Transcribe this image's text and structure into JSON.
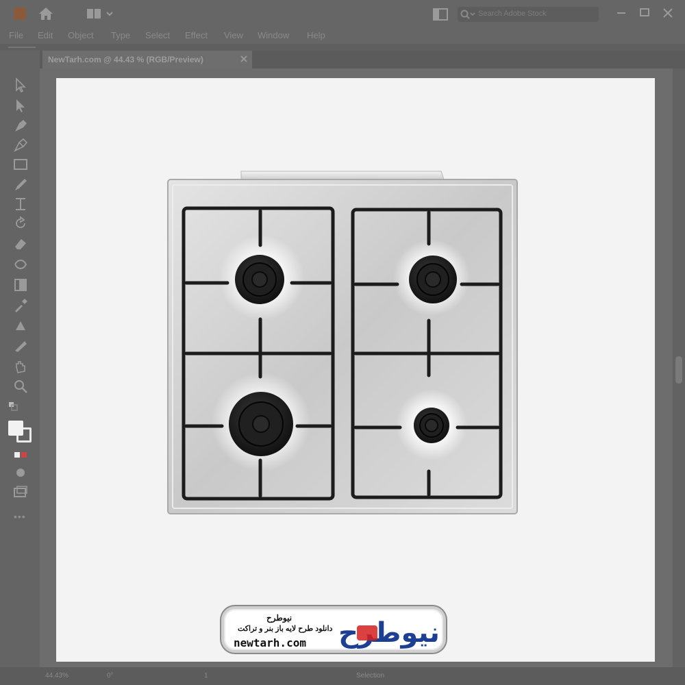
{
  "menubar": {
    "items": [
      "File",
      "Edit",
      "Object",
      "Type",
      "Select",
      "Effect",
      "View",
      "Window",
      "Help"
    ]
  },
  "search": {
    "placeholder": "Search Adobe Stock"
  },
  "document_tab": {
    "title": "NewTarh.com @ 44.43 % (RGB/Preview)"
  },
  "statusbar": {
    "zoom": "44.43%",
    "rotation": "0°",
    "artboard_nav": "1",
    "tool": "Selection"
  },
  "brand": {
    "logo_word": "نیوطرح",
    "name": "نیوطرح",
    "tagline": "دانلود طرح لایه باز بنر و تراکت",
    "url": "newtarh.com"
  },
  "colors": {
    "ui_dark": "#666666",
    "artboard": "#f3f3f3",
    "grate": "#1c1c1c",
    "steel": "#d4d4d4",
    "brand_blue": "#1c3f94",
    "brand_red": "#d62020"
  },
  "icons": {
    "app": "illustrator-logo-icon",
    "home": "home-icon",
    "workspace": "workspace-switcher-icon",
    "search": "search-icon",
    "minimize": "minimize-icon",
    "maximize": "maximize-icon",
    "close": "close-icon"
  }
}
